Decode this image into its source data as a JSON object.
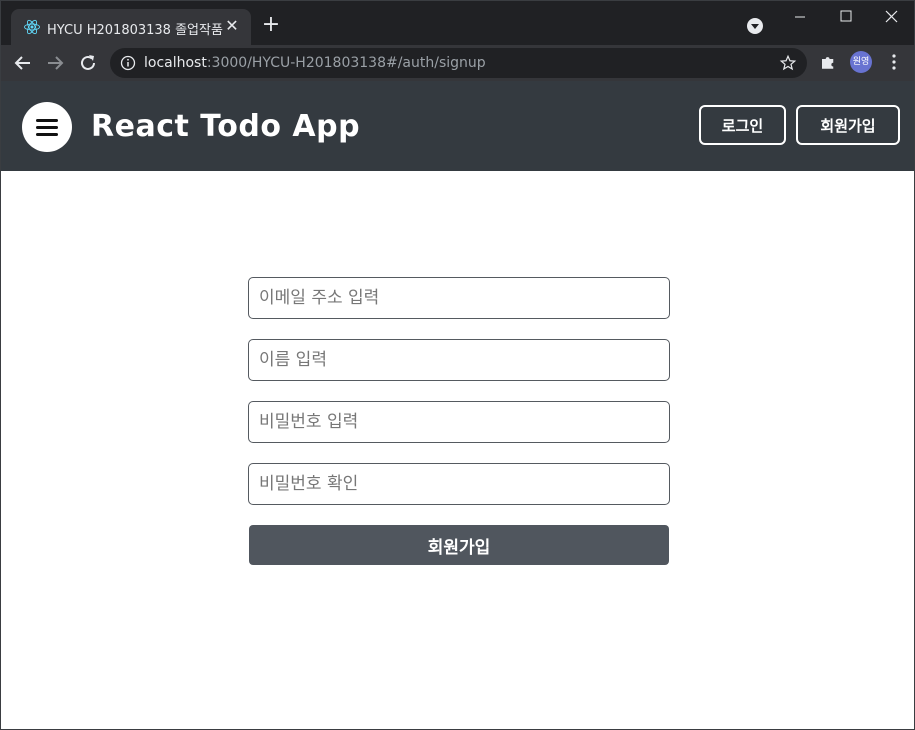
{
  "browser": {
    "tab_title": "HYCU H201803138 졸업작품",
    "url_host": "localhost",
    "url_path": ":3000/HYCU-H201803138#/auth/signup",
    "profile_label": "원영"
  },
  "header": {
    "brand": "React Todo App",
    "login_label": "로그인",
    "signup_label": "회원가입"
  },
  "form": {
    "email_placeholder": "이메일 주소 입력",
    "name_placeholder": "이름 입력",
    "password_placeholder": "비밀번호 입력",
    "password_confirm_placeholder": "비밀번호 확인",
    "submit_label": "회원가입"
  },
  "colors": {
    "header_bg": "#343a40",
    "submit_bg": "#50565e",
    "browser_bg": "#202124",
    "toolbar_bg": "#35363a"
  }
}
